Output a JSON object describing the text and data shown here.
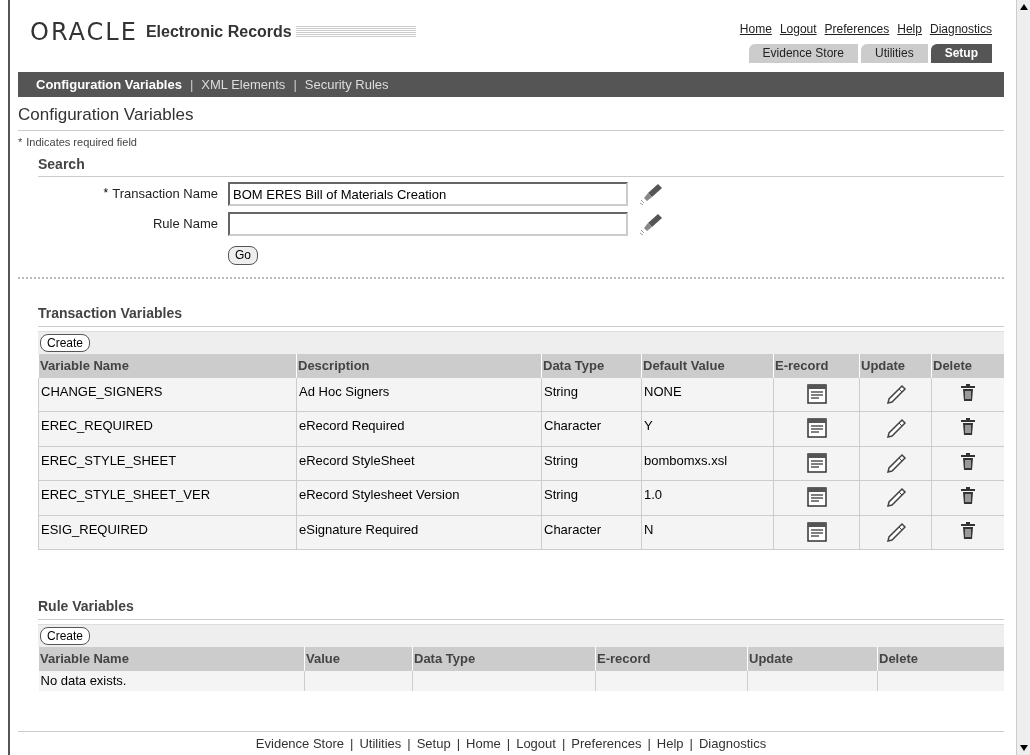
{
  "header": {
    "logo": "ORACLE",
    "product": "Electronic Records",
    "global_links": [
      "Home",
      "Logout",
      "Preferences",
      "Help",
      "Diagnostics"
    ]
  },
  "tabs": [
    {
      "label": "Evidence Store",
      "selected": false
    },
    {
      "label": "Utilities",
      "selected": false
    },
    {
      "label": "Setup",
      "selected": true
    }
  ],
  "subtab_separator": "|",
  "subtabs": [
    {
      "label": "Configuration Variables",
      "selected": true
    },
    {
      "label": "XML Elements",
      "selected": false
    },
    {
      "label": "Security Rules",
      "selected": false
    }
  ],
  "page_title": "Configuration Variables",
  "required_mark": "*",
  "required_note": "Indicates required field",
  "search": {
    "title": "Search",
    "fields": [
      {
        "label": "Transaction Name",
        "required": true,
        "value": "BOM ERES Bill of Materials Creation"
      },
      {
        "label": "Rule Name",
        "required": false
      }
    ],
    "go_button": "Go"
  },
  "transaction_variables": {
    "title": "Transaction Variables",
    "create_button": "Create",
    "columns": [
      "Variable Name",
      "Description",
      "Data Type",
      "Default Value",
      "E-record",
      "Update",
      "Delete"
    ],
    "rows": [
      [
        "CHANGE_SIGNERS",
        "Ad Hoc Signers",
        "String",
        "NONE"
      ],
      [
        "EREC_REQUIRED",
        "eRecord Required",
        "Character",
        "Y"
      ],
      [
        "EREC_STYLE_SHEET",
        "eRecord StyleSheet",
        "String",
        "bombomxs.xsl"
      ],
      [
        "EREC_STYLE_SHEET_VER",
        "eRecord Stylesheet Version",
        "String",
        "1.0"
      ],
      [
        "ESIG_REQUIRED",
        "eSignature Required",
        "Character",
        "N"
      ]
    ]
  },
  "rule_variables": {
    "title": "Rule Variables",
    "create_button": "Create",
    "columns": [
      "Variable Name",
      "Value",
      "Data Type",
      "E-record",
      "Update",
      "Delete"
    ],
    "empty_message": "No data exists."
  },
  "footer_separator": "|",
  "footer_links": [
    "Evidence Store",
    "Utilities",
    "Setup",
    "Home",
    "Logout",
    "Preferences",
    "Help",
    "Diagnostics"
  ]
}
